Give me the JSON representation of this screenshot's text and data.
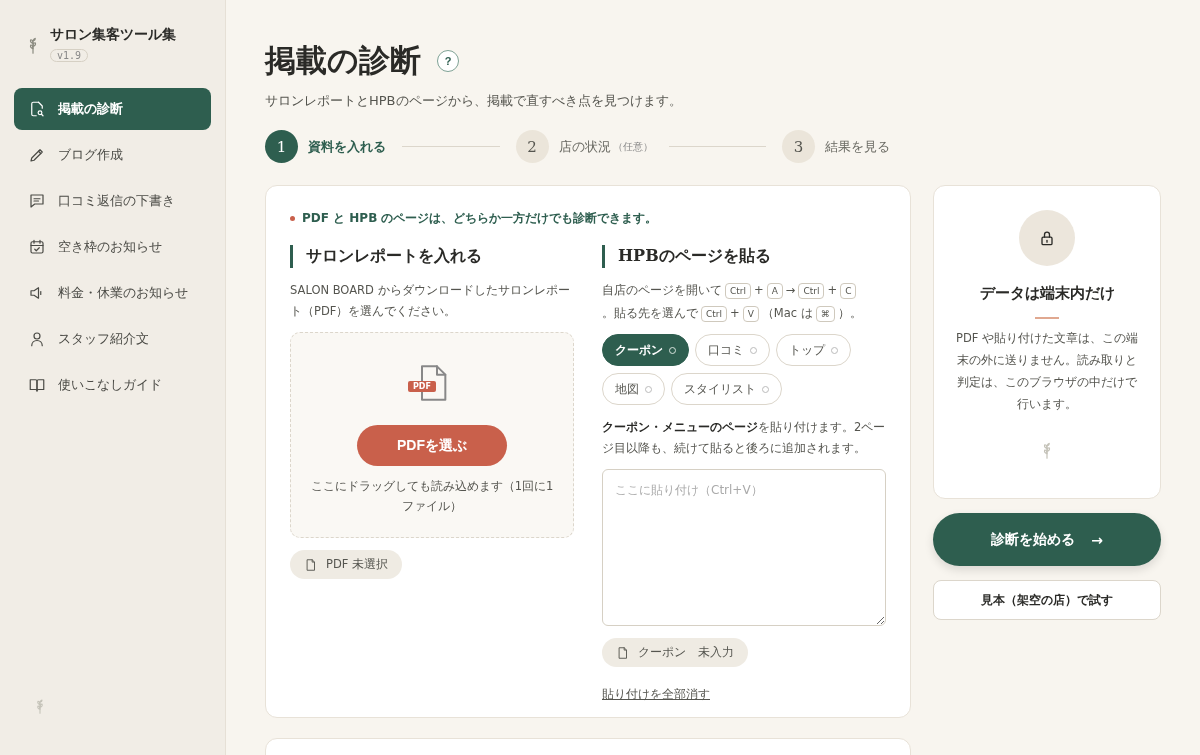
{
  "sidebar": {
    "app_title": "サロン集客ツール集",
    "version": "v1.9",
    "items": [
      {
        "label": "掲載の診断",
        "kind": "doc-search",
        "selected": true
      },
      {
        "label": "ブログ作成",
        "kind": "pencil",
        "selected": false
      },
      {
        "label": "口コミ返信の下書き",
        "kind": "chat",
        "selected": false
      },
      {
        "label": "空き枠のお知らせ",
        "kind": "calendar",
        "selected": false
      },
      {
        "label": "料金・休業のお知らせ",
        "kind": "speaker",
        "selected": false
      },
      {
        "label": "スタッフ紹介文",
        "kind": "person",
        "selected": false
      },
      {
        "label": "使いこなしガイド",
        "kind": "book",
        "selected": false
      }
    ]
  },
  "header": {
    "title": "掲載の診断",
    "help": "?",
    "subtitle": "サロンレポートとHPBのページから、掲載で直すべき点を見つけます。"
  },
  "steps": [
    {
      "number": "1",
      "label": "資料を入れる",
      "selected": true
    },
    {
      "number": "2",
      "label": "店の状況",
      "note": "（任意）",
      "selected": false
    },
    {
      "number": "3",
      "label": "結果を見る",
      "selected": false
    }
  ],
  "input_card": {
    "notice": "PDF と HPB のページは、どちらか一方だけでも診断できます。",
    "pdf_section": {
      "heading": "サロンレポートを入れる",
      "description": "SALON BOARD からダウンロードしたサロンレポート（PDF）を選んでください。",
      "file_badge": "PDF",
      "choose_button": "PDFを選ぶ",
      "drop_hint": "ここにドラッグしても読み込めます（1回に1ファイル）",
      "status": "PDF 未選択"
    },
    "hpb_section": {
      "heading": "HPBのページを貼る",
      "instructions": [
        {
          "kind": "text",
          "text": "自店のページを開いて"
        },
        {
          "kind": "key",
          "text": "Ctrl"
        },
        {
          "kind": "text",
          "text": "+"
        },
        {
          "kind": "key",
          "text": "A"
        },
        {
          "kind": "text",
          "text": "→"
        },
        {
          "kind": "key",
          "text": "Ctrl"
        },
        {
          "kind": "text",
          "text": "+"
        },
        {
          "kind": "key",
          "text": "C"
        },
        {
          "kind": "text",
          "text": "。貼る先を選んで"
        },
        {
          "kind": "key",
          "text": "Ctrl"
        },
        {
          "kind": "text",
          "text": "+"
        },
        {
          "kind": "key",
          "text": "V"
        },
        {
          "kind": "text",
          "text": "（Mac は"
        },
        {
          "kind": "key",
          "text": "⌘"
        },
        {
          "kind": "text",
          "text": "）。"
        }
      ],
      "tabs": [
        {
          "label": "クーポン",
          "selected": true,
          "filled": false
        },
        {
          "label": "口コミ",
          "selected": false,
          "filled": false
        },
        {
          "label": "トップ",
          "selected": false,
          "filled": false
        },
        {
          "label": "地図",
          "selected": false,
          "filled": false
        },
        {
          "label": "スタイリスト",
          "selected": false,
          "filled": false
        }
      ],
      "tab_description": "**クーポン・メニューのページ**を貼り付けます。2ページ目以降も、続けて貼ると後ろに追加されます。",
      "paste_field": {
        "placeholder": "ここに貼り付け（Ctrl+V）"
      },
      "status": {
        "label": "クーポン",
        "value": "未入力"
      },
      "clear_link": "貼り付けを全部消す"
    }
  },
  "privacy_card": {
    "title": "データは端末内だけ",
    "body": "PDF や貼り付けた文章は、この端末の外に送りません。読み取りと判定は、このブラウザの中だけで行います。"
  },
  "start_button": {
    "label": "診断を始める",
    "arrow": "→"
  },
  "sample_button": "見本（架空の店）で試す"
}
